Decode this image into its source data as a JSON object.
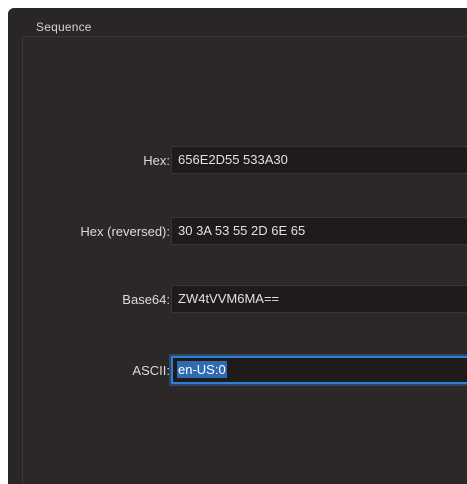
{
  "group": {
    "title": "Sequence"
  },
  "fields": {
    "hex": {
      "label": "Hex:",
      "value": "656E2D55 533A30"
    },
    "hex_reversed": {
      "label": "Hex (reversed):",
      "value": "30 3A 53 55 2D 6E 65"
    },
    "base64": {
      "label": "Base64:",
      "value": "ZW4tVVM6MA=="
    },
    "ascii": {
      "label": "ASCII:",
      "value": "en-US:0"
    }
  },
  "colors": {
    "background": "#2a2626",
    "field_background": "#1f1b1b",
    "focus_ring": "#2f7fd6",
    "selection": "#2f6bb0"
  }
}
